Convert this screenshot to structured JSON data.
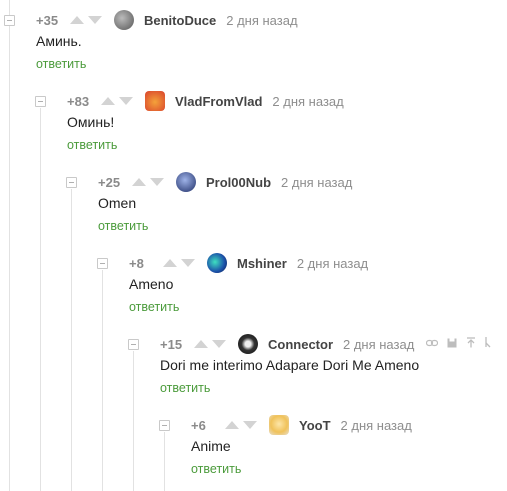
{
  "comments": [
    {
      "rating": "+35",
      "author": "BenitoDuce",
      "time": "2 дня назад",
      "text": "Аминь.",
      "reply": "ответить",
      "avatar_color": "#6d6d6d"
    },
    {
      "rating": "+83",
      "author": "VladFromVlad",
      "time": "2 дня назад",
      "text": "Оминь!",
      "reply": "ответить",
      "avatar_color": "#d9412c"
    },
    {
      "rating": "+25",
      "author": "Prol00Nub",
      "time": "2 дня назад",
      "text": "Omen",
      "reply": "ответить",
      "avatar_color": "#2c3e7a"
    },
    {
      "rating": "+8",
      "author": "Mshiner",
      "time": "2 дня назад",
      "text": "Ameno",
      "reply": "ответить",
      "avatar_color": "#1c7ea8"
    },
    {
      "rating": "+15",
      "author": "Connector",
      "time": "2 дня назад",
      "text": "Dori me interimo Adapare Dori Me Ameno",
      "reply": "ответить",
      "avatar_color": "#2b2b2b",
      "tools": [
        "link-icon",
        "save-icon",
        "scroll-top-icon",
        "branch-icon"
      ]
    },
    {
      "rating": "+6",
      "author": "YooT",
      "time": "2 дня назад",
      "text": "Anime",
      "reply": "ответить",
      "avatar_color": "#f0c25a"
    }
  ],
  "colors": {
    "reply_link": "#4b9b3b",
    "rating": "#8a8a8a",
    "thread_line": "#e2e2e2"
  }
}
